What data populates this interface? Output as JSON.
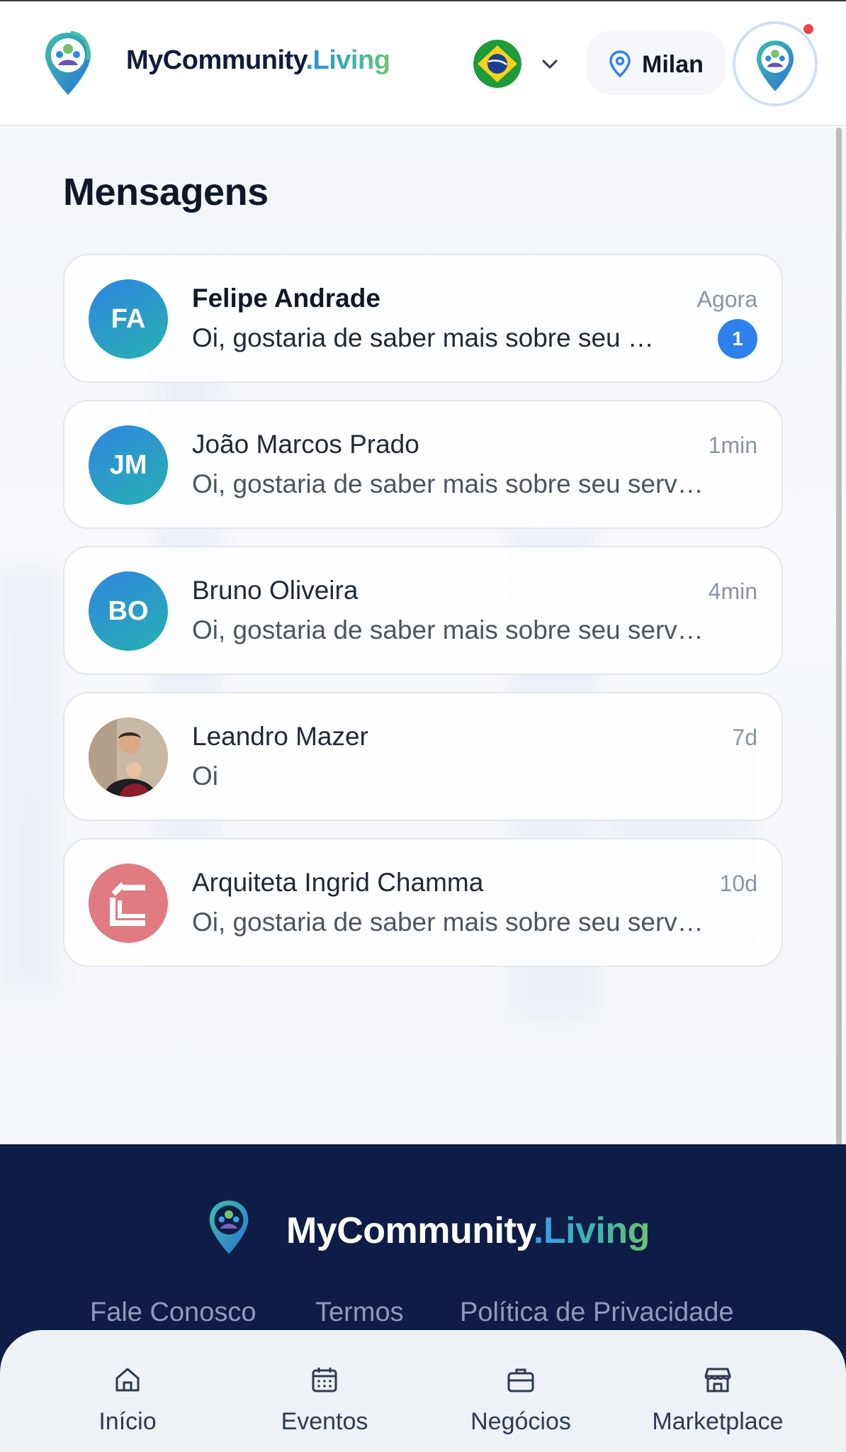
{
  "header": {
    "brand_main": "MyCommunity",
    "brand_dot": ".",
    "brand_accent": "Living",
    "language_flag": "brazil-flag-icon",
    "location": "Milan",
    "has_notification": true
  },
  "page": {
    "title": "Mensagens"
  },
  "conversations": [
    {
      "initials": "FA",
      "name": "Felipe Andrade",
      "preview": "Oi, gostaria de saber mais sobre seu …",
      "time": "Agora",
      "unread_count": "1"
    },
    {
      "initials": "JM",
      "name": "João Marcos Prado",
      "preview": "Oi, gostaria de saber mais sobre seu serv…",
      "time": "1min"
    },
    {
      "initials": "BO",
      "name": "Bruno Oliveira",
      "preview": "Oi, gostaria de saber mais sobre seu serv…",
      "time": "4min"
    },
    {
      "initials": "",
      "name": "Leandro Mazer",
      "preview": "Oi",
      "time": "7d",
      "avatar": "photo"
    },
    {
      "initials": "",
      "name": "Arquiteta Ingrid Chamma",
      "preview": "Oi, gostaria de saber mais sobre seu serv…",
      "time": "10d",
      "avatar": "brand-logo"
    }
  ],
  "footer": {
    "brand_main": "MyCommunity",
    "brand_dot": ".",
    "brand_accent": "Living",
    "links": [
      "Fale Conosco",
      "Termos",
      "Política de Privacidade"
    ]
  },
  "bottom_nav": [
    {
      "label": "Início",
      "icon": "home-icon"
    },
    {
      "label": "Eventos",
      "icon": "calendar-icon"
    },
    {
      "label": "Negócios",
      "icon": "briefcase-icon"
    },
    {
      "label": "Marketplace",
      "icon": "store-icon"
    }
  ],
  "colors": {
    "accent": "#2f80ed",
    "footer_bg": "#0e1d45",
    "badge": "#2f80ed"
  }
}
